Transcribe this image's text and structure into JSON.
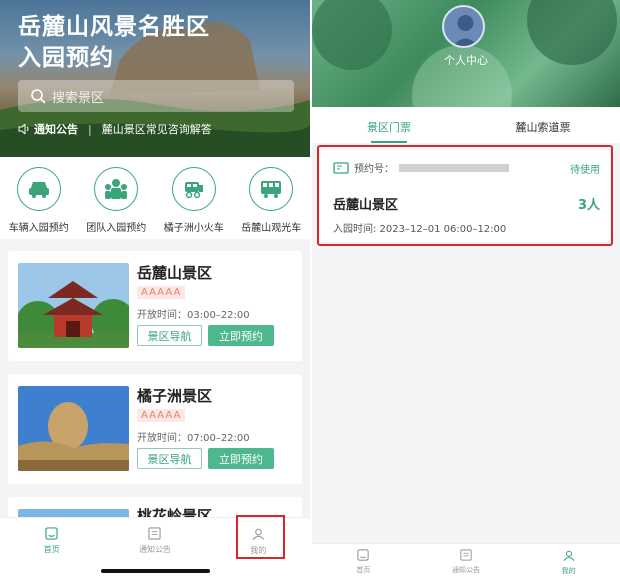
{
  "left": {
    "hero": {
      "title_line1": "岳麓山风景名胜区",
      "title_line2": "入园预约",
      "search_placeholder": "搜索景区",
      "notice_label": "通知公告",
      "notice_text": "麓山景区常见咨询解答"
    },
    "quick": [
      {
        "label": "车辆入园预约",
        "icon": "car-icon"
      },
      {
        "label": "团队入园预约",
        "icon": "group-icon"
      },
      {
        "label": "橘子洲小火车",
        "icon": "train-icon"
      },
      {
        "label": "岳麓山观光车",
        "icon": "bus-icon"
      }
    ],
    "spots": [
      {
        "name": "岳麓山景区",
        "level": "AAAAA",
        "hours": "开放时间：03:00–22:00",
        "nav": "景区导航",
        "book": "立即预约"
      },
      {
        "name": "橘子洲景区",
        "level": "AAAAA",
        "hours": "开放时间：07:00–22:00",
        "nav": "景区导航",
        "book": "立即预约"
      },
      {
        "name": "桃花岭景区"
      }
    ],
    "tabbar": [
      {
        "label": "首页",
        "icon": "home-icon"
      },
      {
        "label": "通知公告",
        "icon": "notice-icon"
      },
      {
        "label": "我的",
        "icon": "user-icon"
      }
    ]
  },
  "right": {
    "user_center": "个人中心",
    "tabs": [
      "景区门票",
      "麓山索道票"
    ],
    "ticket": {
      "no_label": "预约号：",
      "status": "待使用",
      "name": "岳麓山景区",
      "count": "3人",
      "time": "入园时间: 2023–12–01 06:00–12:00"
    },
    "tabbar": [
      {
        "label": "首页",
        "icon": "home-icon"
      },
      {
        "label": "通知公告",
        "icon": "notice-icon"
      },
      {
        "label": "我的",
        "icon": "user-icon"
      }
    ]
  },
  "colors": {
    "accent": "#3aa57a",
    "highlight": "#d9272e",
    "level_bg": "#fde7e5",
    "level_text": "#f07a6a"
  }
}
